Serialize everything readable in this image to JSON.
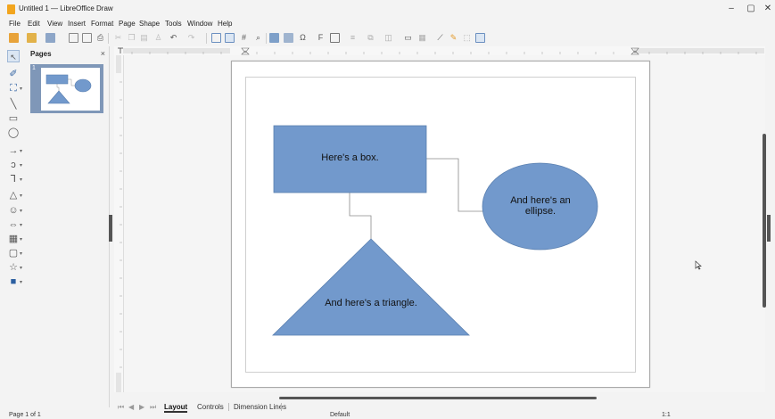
{
  "window": {
    "title": "Untitled 1 — LibreOffice Draw",
    "minimize": "–",
    "maximize": "▢",
    "close": "✕"
  },
  "menu": [
    {
      "label": "File"
    },
    {
      "label": "Edit"
    },
    {
      "label": "View"
    },
    {
      "label": "Insert"
    },
    {
      "label": "Format"
    },
    {
      "label": "Page"
    },
    {
      "label": "Shape"
    },
    {
      "label": "Tools"
    },
    {
      "label": "Window"
    },
    {
      "label": "Help"
    }
  ],
  "pages_panel": {
    "title": "Pages",
    "close": "×",
    "thumbnail_number": "1"
  },
  "drawing": {
    "box_text": "Here's a box.",
    "ellipse_text": "And here's an ellipse.",
    "triangle_text": "And here's a triangle.",
    "fill_color": "#7299cc",
    "stroke_color": "#5b80b0"
  },
  "tabs": {
    "layout": "Layout",
    "controls": "Controls",
    "dimension_lines": "Dimension Lines"
  },
  "status": {
    "page": "Page 1 of 1",
    "layout": "Default",
    "zoom": "1:1"
  }
}
